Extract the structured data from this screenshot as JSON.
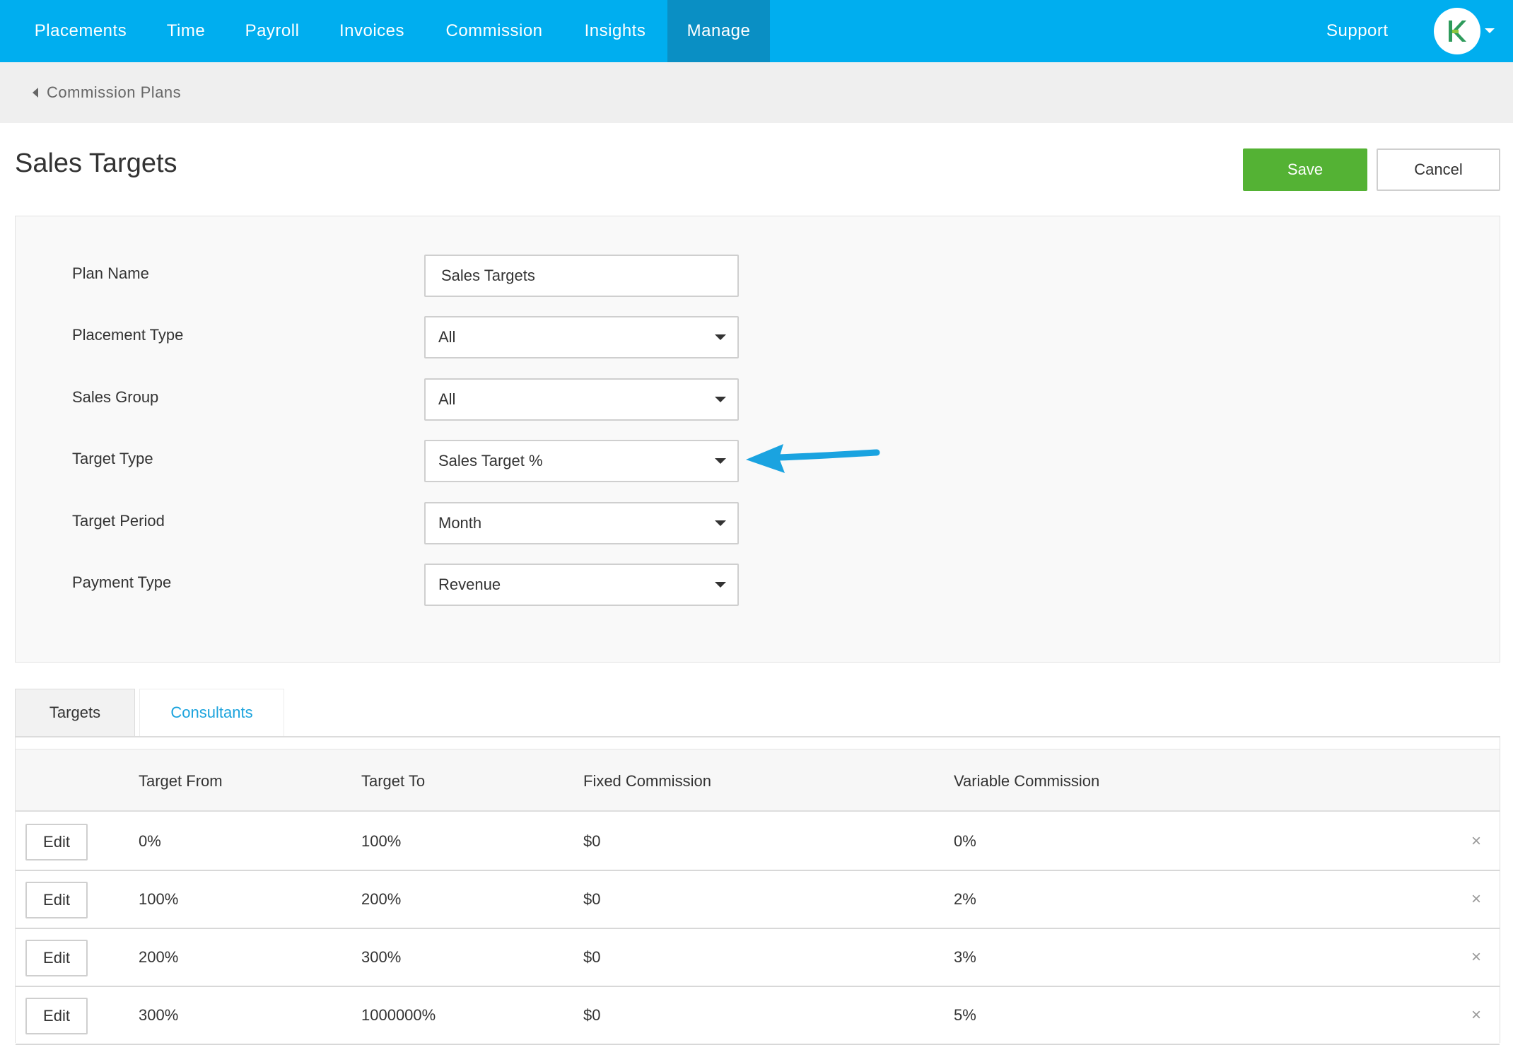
{
  "nav": {
    "items": [
      {
        "label": "Placements"
      },
      {
        "label": "Time"
      },
      {
        "label": "Payroll"
      },
      {
        "label": "Invoices"
      },
      {
        "label": "Commission"
      },
      {
        "label": "Insights"
      },
      {
        "label": "Manage"
      }
    ],
    "active": "Manage",
    "support_label": "Support",
    "avatar_icon": "logo-k-icon"
  },
  "breadcrumb": {
    "label": "Commission Plans"
  },
  "page": {
    "title": "Sales Targets"
  },
  "actions": {
    "save_label": "Save",
    "cancel_label": "Cancel"
  },
  "form": {
    "plan_name": {
      "label": "Plan Name",
      "value": "Sales Targets"
    },
    "placement_type": {
      "label": "Placement Type",
      "value": "All"
    },
    "sales_group": {
      "label": "Sales Group",
      "value": "All"
    },
    "target_type": {
      "label": "Target Type",
      "value": "Sales Target %"
    },
    "target_period": {
      "label": "Target Period",
      "value": "Month"
    },
    "payment_type": {
      "label": "Payment Type",
      "value": "Revenue"
    }
  },
  "tabs": [
    {
      "label": "Targets",
      "active": true
    },
    {
      "label": "Consultants",
      "active": false
    }
  ],
  "table": {
    "columns": [
      "Target From",
      "Target To",
      "Fixed Commission",
      "Variable Commission"
    ],
    "edit_label": "Edit",
    "remove_label": "×",
    "rows": [
      {
        "from": "0%",
        "to": "100%",
        "fixed": "$0",
        "variable": "0%"
      },
      {
        "from": "100%",
        "to": "200%",
        "fixed": "$0",
        "variable": "2%"
      },
      {
        "from": "200%",
        "to": "300%",
        "fixed": "$0",
        "variable": "3%"
      },
      {
        "from": "300%",
        "to": "1000000%",
        "fixed": "$0",
        "variable": "5%"
      }
    ]
  },
  "colors": {
    "nav_bg": "#00aeef",
    "nav_active_bg": "#0a8fc4",
    "save_bg": "#54b234",
    "link": "#1ba3dd",
    "annotation_arrow": "#1aa3e0"
  }
}
